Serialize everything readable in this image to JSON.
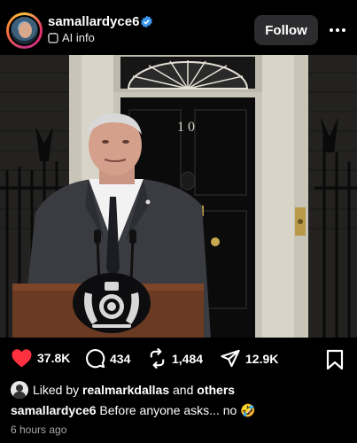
{
  "header": {
    "username": "samallardyce6",
    "ai_info": "AI info",
    "follow_label": "Follow",
    "more_icon": "more-horizontal-icon",
    "verified_color": "#3897f0"
  },
  "photo": {
    "door_number": "10"
  },
  "actions": {
    "likes": "37.8K",
    "comments": "434",
    "reposts": "1,484",
    "shares": "12.9K",
    "like_color": "#ff3040"
  },
  "liked_by": {
    "prefix": "Liked by",
    "user": "realmarkdallas",
    "joiner": "and",
    "others": "others"
  },
  "caption": {
    "username": "samallardyce6",
    "text": "Before anyone asks... no",
    "emoji": "🤣"
  },
  "timestamp": "6 hours ago"
}
